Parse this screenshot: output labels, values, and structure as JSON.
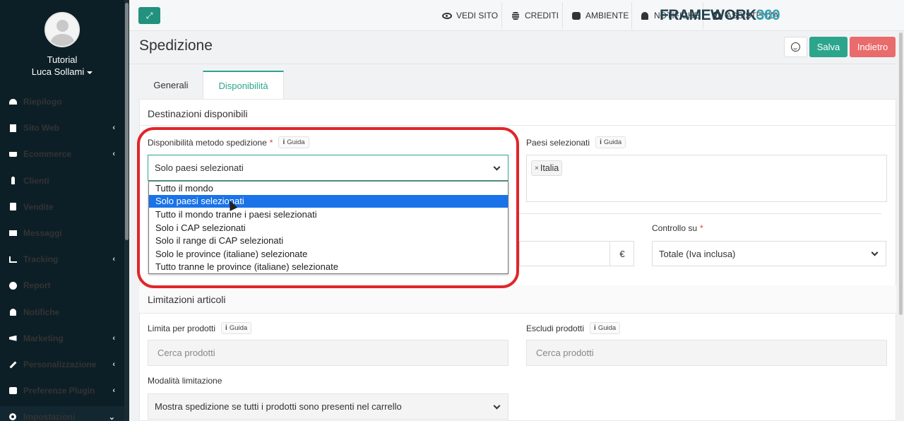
{
  "sidebar": {
    "role": "Tutorial",
    "username": "Luca Sollami",
    "items": [
      {
        "label": "Riepilogo",
        "icon": "dashboard-icon",
        "has_children": false
      },
      {
        "label": "Sito Web",
        "icon": "file-icon",
        "has_children": true
      },
      {
        "label": "Ecommerce",
        "icon": "cart-icon",
        "has_children": true
      },
      {
        "label": "Clienti",
        "icon": "person-icon",
        "has_children": false
      },
      {
        "label": "Vendite",
        "icon": "calculator-icon",
        "has_children": false
      },
      {
        "label": "Messaggi",
        "icon": "mail-icon",
        "has_children": false
      },
      {
        "label": "Tracking",
        "icon": "chart-icon",
        "has_children": true
      },
      {
        "label": "Report",
        "icon": "pie-icon",
        "has_children": false
      },
      {
        "label": "Notifiche",
        "icon": "bell-icon",
        "has_children": false
      },
      {
        "label": "Marketing",
        "icon": "bullhorn-icon",
        "has_children": true
      },
      {
        "label": "Personalizzazione",
        "icon": "brush-icon",
        "has_children": true
      },
      {
        "label": "Preferenze Plugin",
        "icon": "cubes-icon",
        "has_children": true
      },
      {
        "label": "Impostazioni",
        "icon": "gear-icon",
        "has_children": true
      }
    ]
  },
  "topbar": {
    "links": [
      {
        "label": "VEDI SITO",
        "icon": "eye-icon"
      },
      {
        "label": "CREDITI",
        "icon": "coins-icon"
      },
      {
        "label": "AMBIENTE",
        "icon": "cubes-icon"
      },
      {
        "label": "NOTIFICHE",
        "icon": "bell-icon"
      },
      {
        "label": "ASSISTENZA",
        "icon": "lifebuoy-icon"
      }
    ],
    "brand_main": "FRAMEWORK",
    "brand_accent": "360"
  },
  "page": {
    "title": "Spedizione",
    "save_label": "Salva",
    "back_label": "Indietro"
  },
  "tabs": [
    {
      "label": "Generali",
      "active": false
    },
    {
      "label": "Disponibilità",
      "active": true
    }
  ],
  "destinations": {
    "section_title": "Destinazioni disponibili",
    "availability_label": "Disponibilità metodo spedizione",
    "required_mark": "*",
    "guide_label": "Guida",
    "availability_value": "Solo paesi selezionati",
    "options": [
      "Tutto il mondo",
      "Solo paesi selezionati",
      "Tutto il mondo tranne i paesi selezionati",
      "Solo i CAP selezionati",
      "Solo il range di CAP selezionati",
      "Solo le province (italiane) selezionate",
      "Tutto tranne le province (italiane) selezionate"
    ],
    "selected_index": 1,
    "countries_label": "Paesi selezionati",
    "countries": [
      "Italia"
    ],
    "currency_symbol": "€",
    "control_label": "Controllo su",
    "control_value": "Totale (Iva inclusa)"
  },
  "limits": {
    "section_title": "Limitazioni articoli",
    "limit_label": "Limita per prodotti",
    "limit_placeholder": "Cerca prodotti",
    "exclude_label": "Escludi prodotti",
    "exclude_placeholder": "Cerca prodotti",
    "mode_label": "Modalità limitazione",
    "mode_value": "Mostra spedizione se tutti i prodotti sono presenti nel carrello"
  },
  "colors": {
    "sidebar_bg": "#0d1f26",
    "accent": "#2ca58d",
    "danger": "#e96b6b",
    "highlight": "#e0262b",
    "selection": "#1a73e8"
  }
}
